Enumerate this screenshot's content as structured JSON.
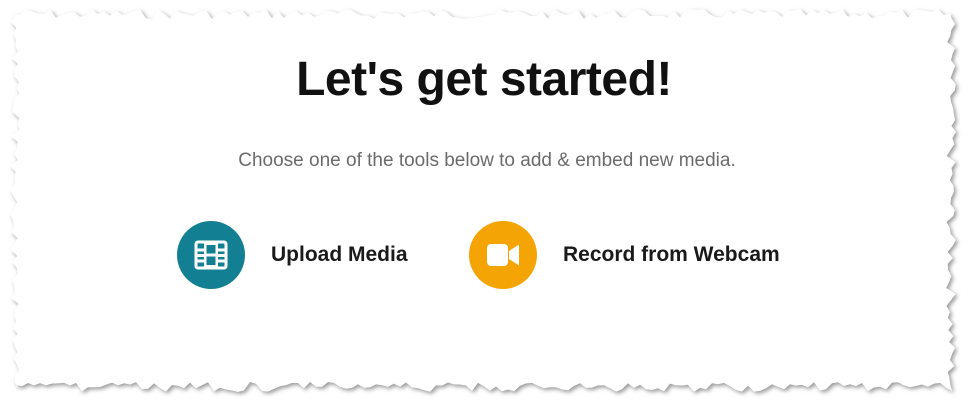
{
  "heading": "Let's get started!",
  "subheading": "Choose one of the tools below to add & embed new media.",
  "tools": [
    {
      "label": "Upload Media",
      "icon": "film-icon",
      "color": "#137f92"
    },
    {
      "label": "Record from Webcam",
      "icon": "video-camera-icon",
      "color": "#f4a405"
    }
  ],
  "colors": {
    "background": "#ffffff",
    "frame_shadow": "#9a9a9a"
  }
}
